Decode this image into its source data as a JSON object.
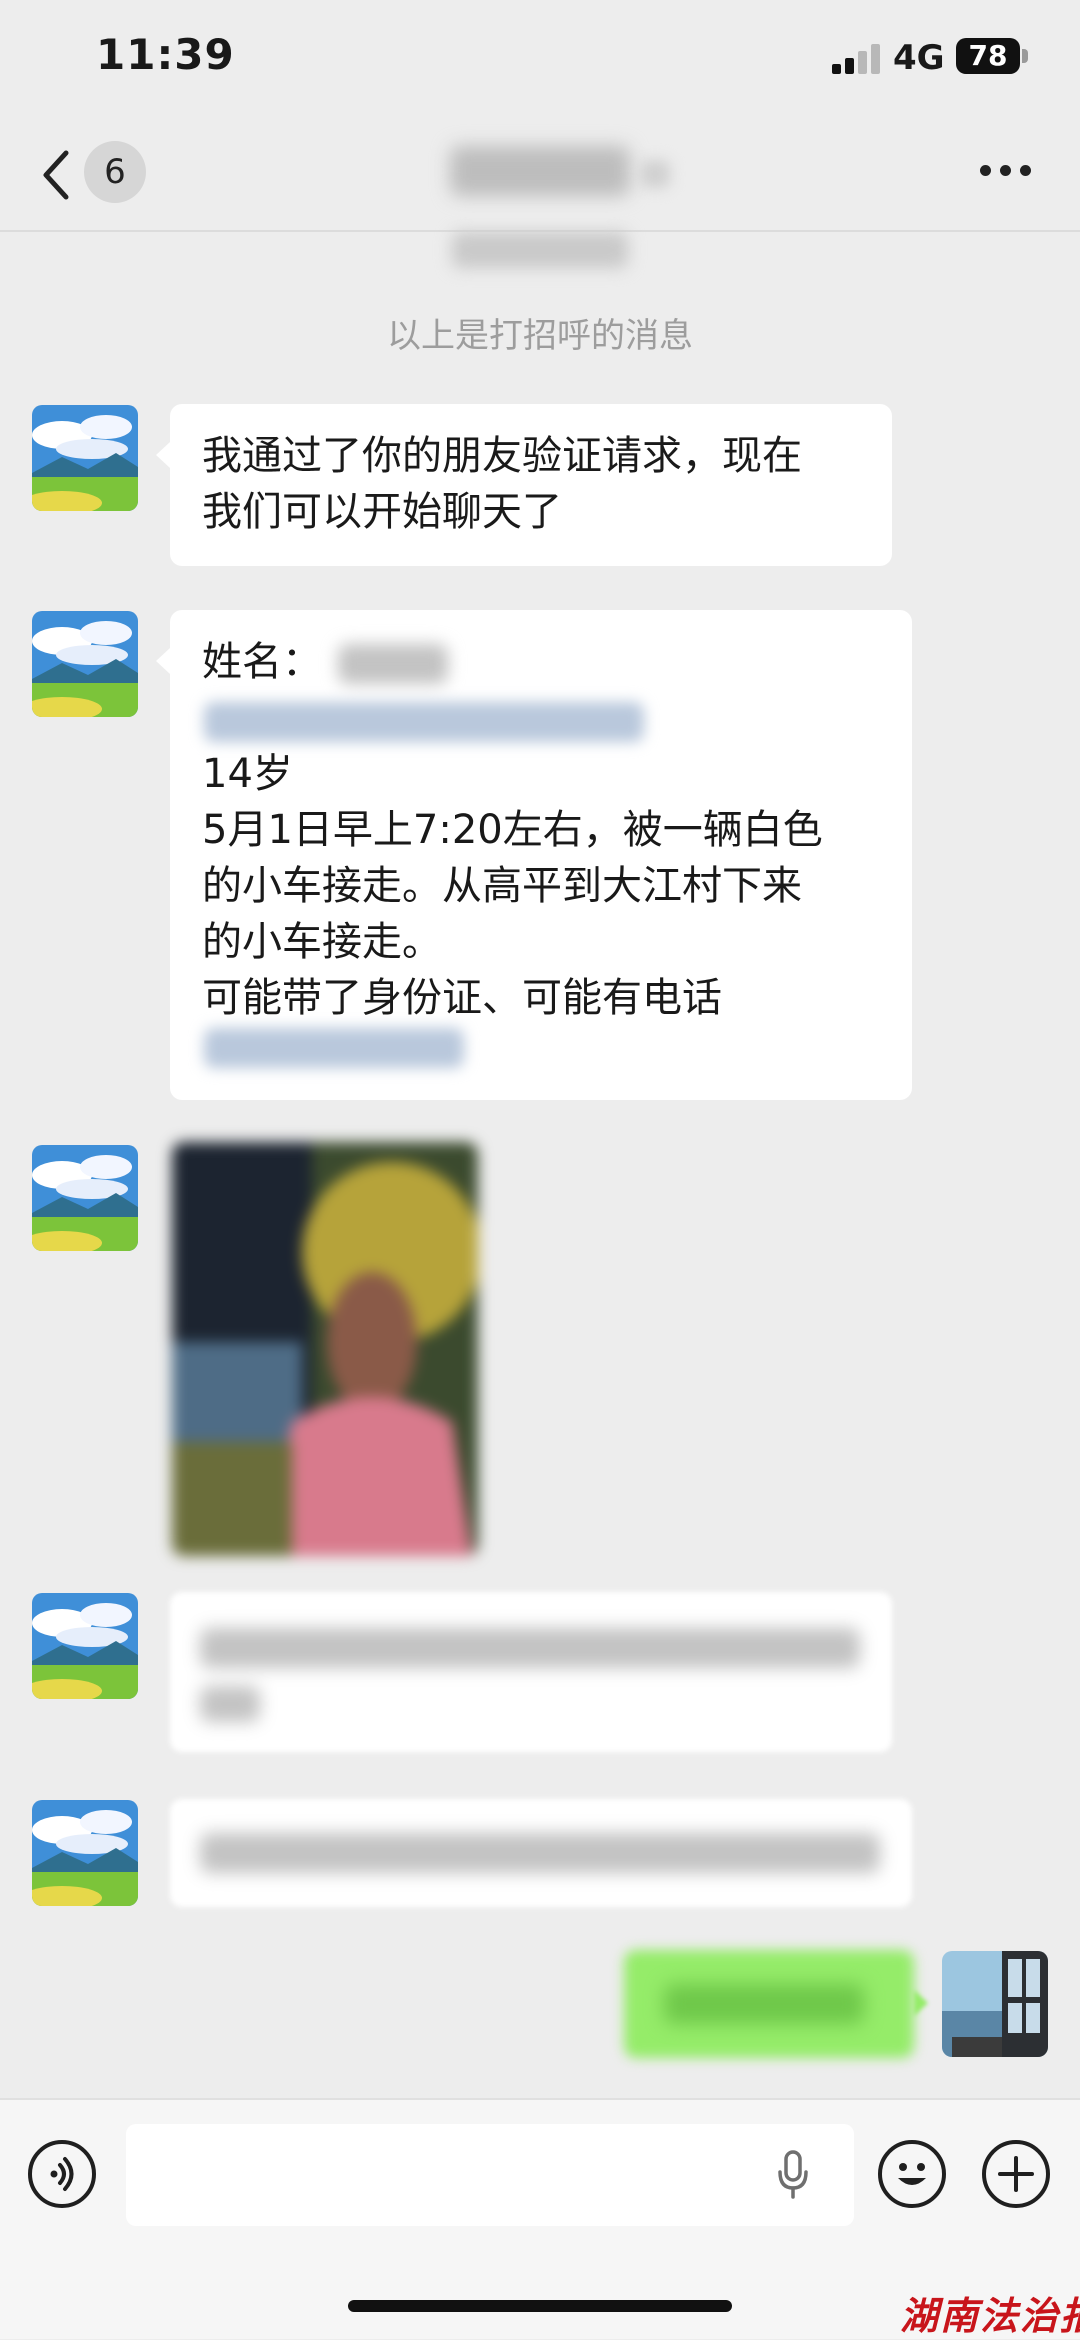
{
  "status_bar": {
    "time": "11:39",
    "network": "4G",
    "battery": "78"
  },
  "nav": {
    "unread_count": "6"
  },
  "system_message": "以上是打招呼的消息",
  "messages": {
    "m1": {
      "lines": [
        "我通过了你的朋友验证请求，现在",
        "我们可以开始聊天了"
      ]
    },
    "m2": {
      "name_label": "姓名：",
      "age": "14岁",
      "lines": [
        "5月1日早上7:20左右，被一辆白色",
        "的小车接走。从高平到大江村下来",
        "的小车接走。",
        "可能带了身份证、可能有电话"
      ]
    }
  },
  "input": {
    "placeholder": ""
  },
  "watermark": "湖南法治报",
  "colors": {
    "background": "#ededed",
    "bubble_in": "#ffffff",
    "bubble_out": "#95ec69",
    "watermark": "#c8151b"
  }
}
